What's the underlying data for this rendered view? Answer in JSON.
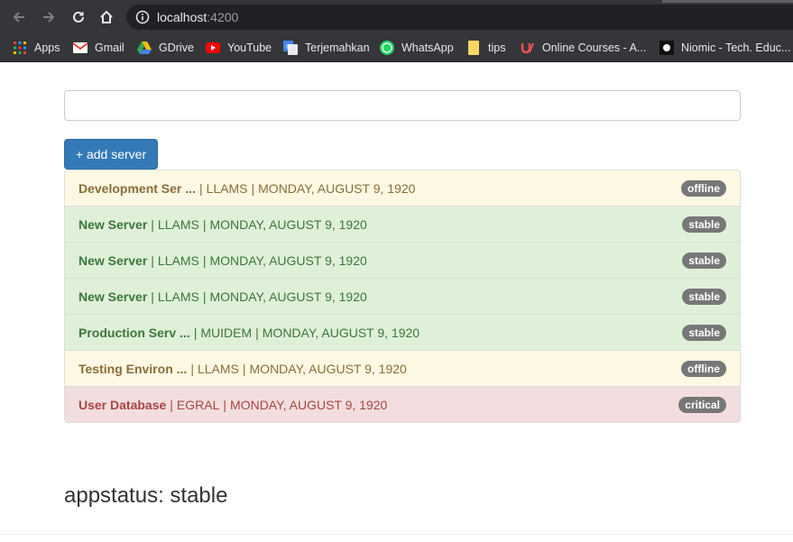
{
  "browser": {
    "url_host": "localhost",
    "url_port": ":4200",
    "bookmarks": [
      {
        "label": "Apps",
        "icon": "apps-grid-icon"
      },
      {
        "label": "Gmail",
        "icon": "gmail-icon"
      },
      {
        "label": "GDrive",
        "icon": "gdrive-icon"
      },
      {
        "label": "YouTube",
        "icon": "youtube-icon"
      },
      {
        "label": "Terjemahkan",
        "icon": "translate-icon"
      },
      {
        "label": "WhatsApp",
        "icon": "whatsapp-icon"
      },
      {
        "label": "tips",
        "icon": "folder-icon"
      },
      {
        "label": "Online Courses - A...",
        "icon": "udemy-icon"
      },
      {
        "label": "Niomic - Tech. Educ...",
        "icon": "niomic-icon"
      }
    ]
  },
  "page": {
    "filter_input_value": "",
    "add_button_label": "+ add server",
    "servers": [
      {
        "name": "Development Ser ...",
        "instance": "LLAMS",
        "date": "MONDAY, AUGUST 9, 1920",
        "status": "offline",
        "variant": "warning"
      },
      {
        "name": "New Server",
        "instance": "LLAMS",
        "date": "MONDAY, AUGUST 9, 1920",
        "status": "stable",
        "variant": "success"
      },
      {
        "name": "New Server",
        "instance": "LLAMS",
        "date": "MONDAY, AUGUST 9, 1920",
        "status": "stable",
        "variant": "success"
      },
      {
        "name": "New Server",
        "instance": "LLAMS",
        "date": "MONDAY, AUGUST 9, 1920",
        "status": "stable",
        "variant": "success"
      },
      {
        "name": "Production Serv ...",
        "instance": "MUIDEM",
        "date": "MONDAY, AUGUST 9, 1920",
        "status": "stable",
        "variant": "success"
      },
      {
        "name": "Testing Environ ...",
        "instance": "LLAMS",
        "date": "MONDAY, AUGUST 9, 1920",
        "status": "offline",
        "variant": "warning"
      },
      {
        "name": "User Database",
        "instance": "EGRAL",
        "date": "MONDAY, AUGUST 9, 1920",
        "status": "critical",
        "variant": "danger"
      }
    ],
    "separator": "|",
    "appstatus_label": "appstatus: stable"
  },
  "colors": {
    "primary": "#337ab7",
    "warning_bg": "#fcf8e3",
    "success_bg": "#dff0d8",
    "danger_bg": "#f2dede",
    "badge_bg": "#777777"
  }
}
